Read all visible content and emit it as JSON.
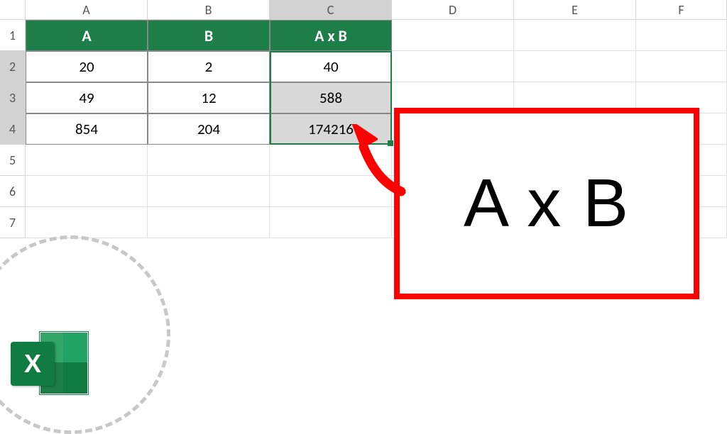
{
  "columns": [
    "A",
    "B",
    "C",
    "D",
    "E",
    "F"
  ],
  "rows": [
    "1",
    "2",
    "3",
    "4",
    "5",
    "6",
    "7"
  ],
  "table": {
    "headers": {
      "colA": "A",
      "colB": "B",
      "colC": "A x B"
    },
    "data": [
      {
        "a": "20",
        "b": "2",
        "c": "40"
      },
      {
        "a": "49",
        "b": "12",
        "c": "588"
      },
      {
        "a": "854",
        "b": "204",
        "c": "174216"
      }
    ]
  },
  "callout": {
    "text": "A x B"
  },
  "icons": {
    "excel_x": "X"
  },
  "colors": {
    "header_green": "#1e7e47",
    "callout_red": "#ff0000",
    "excel_green": "#107c41"
  }
}
